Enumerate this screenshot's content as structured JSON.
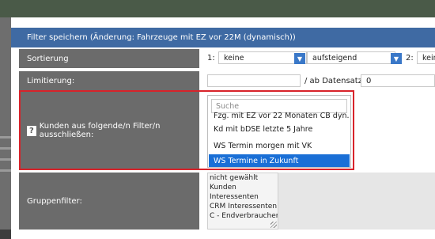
{
  "modal": {
    "title": "Filter speichern (Änderung: Fahrzeuge mit EZ vor 22M (dynamisch))"
  },
  "sort": {
    "label": "Sortierung",
    "index1": "1:",
    "field1": "keine",
    "direction": "aufsteigend",
    "index2": "2:",
    "field2": "kein"
  },
  "limit": {
    "label": "Limitierung:",
    "from_label": "/ ab Datensatz:",
    "from_value": "0",
    "value": ""
  },
  "exclude": {
    "help": "?",
    "label": "Kunden aus folgende/n Filter/n ausschließen:",
    "search_placeholder": "Suche",
    "options": [
      "Fzg. mit EZ vor 22 Monaten CB dyn.",
      "Kd mit bDSE letzte 5 Jahre",
      "WS Termin morgen mit VK",
      "WS Termine in Zukunft"
    ],
    "selected": "WS Termine in Zukunft"
  },
  "groups": {
    "label": "Gruppenfilter:",
    "options": [
      "nicht gewählt",
      "Kunden",
      "Interessenten",
      "CRM Interessenten",
      "C - Endverbraucher"
    ]
  },
  "colors": {
    "header": "#3f6aa3",
    "label_bg": "#6b6b6b",
    "selection": "#1a6fd6",
    "highlight_frame": "#d8232a"
  }
}
